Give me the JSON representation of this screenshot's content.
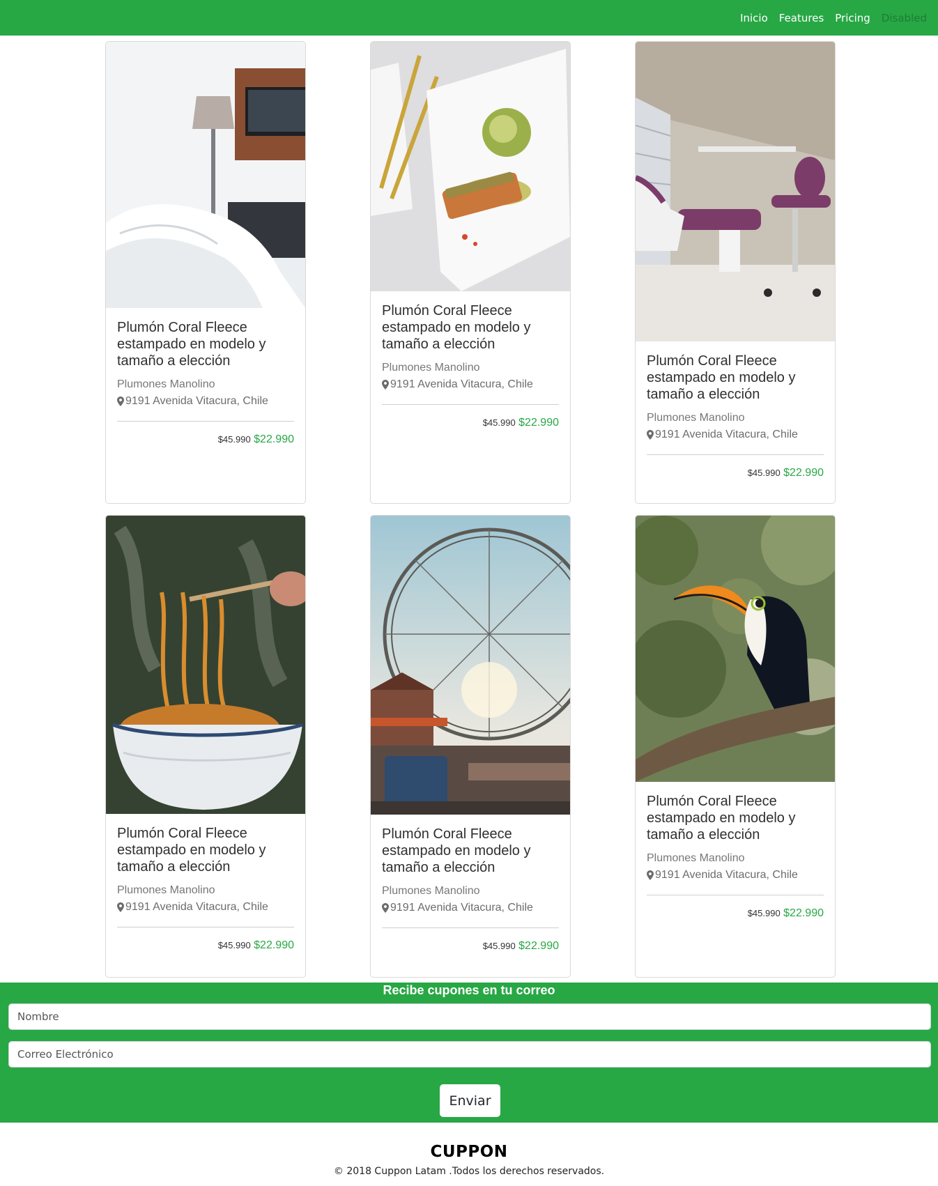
{
  "nav": {
    "items": [
      {
        "label": "Inicio"
      },
      {
        "label": "Features"
      },
      {
        "label": "Pricing"
      },
      {
        "label": "Disabled"
      }
    ]
  },
  "cards": [
    {
      "image": "hotel-bedroom",
      "title": "Plumón Coral Fleece estampado en modelo y tamaño a elección",
      "merchant": "Plumones Manolino",
      "address": "9191 Avenida Vitacura, Chile",
      "old_price": "$45.990",
      "new_price": "$22.990"
    },
    {
      "image": "salmon-dish",
      "title": "Plumón Coral Fleece estampado en modelo y tamaño a elección",
      "merchant": "Plumones Manolino",
      "address": "9191 Avenida Vitacura, Chile",
      "old_price": "$45.990",
      "new_price": "$22.990"
    },
    {
      "image": "dental-chair",
      "title": "Plumón Coral Fleece estampado en modelo y tamaño a elección",
      "merchant": "Plumones Manolino",
      "address": "9191 Avenida Vitacura, Chile",
      "old_price": "$45.990",
      "new_price": "$22.990"
    },
    {
      "image": "noodle-bowl",
      "title": "Plumón Coral Fleece estampado en modelo y tamaño a elección",
      "merchant": "Plumones Manolino",
      "address": "9191 Avenida Vitacura, Chile",
      "old_price": "$45.990",
      "new_price": "$22.990"
    },
    {
      "image": "ferris-wheel",
      "title": "Plumón Coral Fleece estampado en modelo y tamaño a elección",
      "merchant": "Plumones Manolino",
      "address": "9191 Avenida Vitacura, Chile",
      "old_price": "$45.990",
      "new_price": "$22.990"
    },
    {
      "image": "toucan",
      "title": "Plumón Coral Fleece estampado en modelo y tamaño a elección",
      "merchant": "Plumones Manolino",
      "address": "9191 Avenida Vitacura, Chile",
      "old_price": "$45.990",
      "new_price": "$22.990"
    }
  ],
  "newsletter": {
    "title": "Recibe cupones en tu correo",
    "name_placeholder": "Nombre",
    "email_placeholder": "Correo Electrónico",
    "submit_label": "Enviar"
  },
  "footer": {
    "logo": "CUPPON",
    "copyright": "© 2018 Cuppon Latam .Todos los derechos reservados."
  },
  "colors": {
    "brand_green": "#28a745",
    "price_green": "#28a745",
    "white": "#ffffff"
  }
}
